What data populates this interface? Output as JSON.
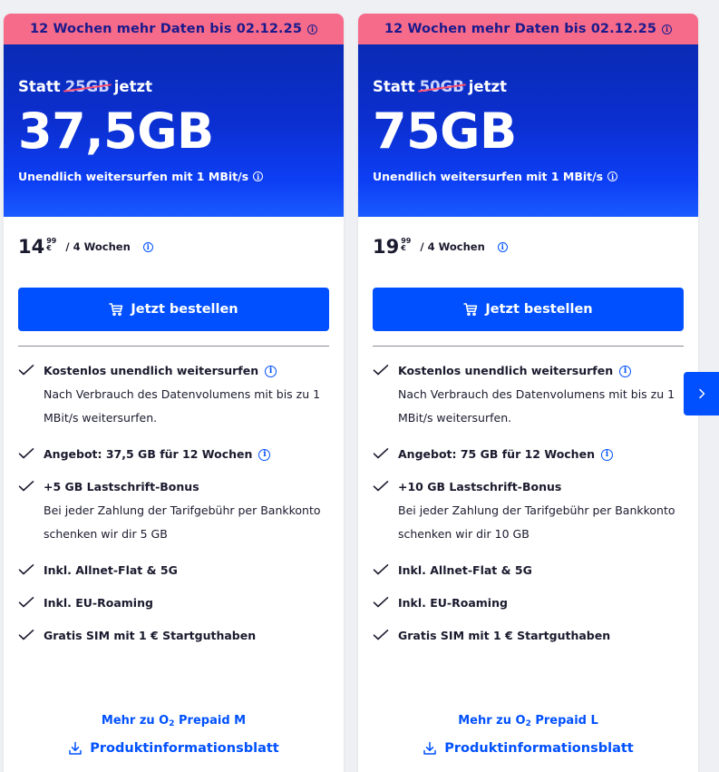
{
  "colors": {
    "promo_bg": "#f76b8a",
    "promo_text": "#1a1a8c",
    "hero_blue": "#0a2bb4",
    "accent_blue": "#0050ff",
    "strike_red": "#ff4d6d"
  },
  "icons": [
    "info-icon",
    "cart-icon",
    "check-icon",
    "download-icon",
    "chevron-right-icon"
  ],
  "cards": [
    {
      "promo": "12 Wochen mehr Daten bis 02.12.25",
      "statt_prefix": "Statt",
      "old_volume": "25GB",
      "statt_suffix": "jetzt",
      "new_volume": "37,5GB",
      "surf_text": "Unendlich weitersurfen mit 1 MBit/s",
      "price_main": "14",
      "price_cents": "99",
      "currency": "€",
      "period": "/ 4 Wochen",
      "order_label": "Jetzt bestellen",
      "features": [
        {
          "title": "Kostenlos unendlich weitersurfen",
          "info": true,
          "desc": "Nach Verbrauch des Datenvolumens mit bis zu 1 MBit/s weitersurfen."
        },
        {
          "title": "Angebot: 37,5 GB für 12 Wochen",
          "info": true,
          "desc": ""
        },
        {
          "title": "+5 GB Lastschrift-Bonus",
          "info": false,
          "desc": "Bei jeder Zahlung der Tarifgebühr per Bankkonto schenken wir dir 5 GB"
        },
        {
          "title": "Inkl. Allnet-Flat & 5G",
          "info": false,
          "desc": ""
        },
        {
          "title": "Inkl. EU-Roaming",
          "info": false,
          "desc": ""
        },
        {
          "title": "Gratis SIM mit 1 € Startguthaben",
          "info": false,
          "desc": ""
        }
      ],
      "more_prefix": "Mehr zu O",
      "more_sub": "2",
      "more_suffix": " Prepaid M",
      "pib_label": "Produktinformationsblatt"
    },
    {
      "promo": "12 Wochen mehr Daten bis 02.12.25",
      "statt_prefix": "Statt",
      "old_volume": "50GB",
      "statt_suffix": "jetzt",
      "new_volume": "75GB",
      "surf_text": "Unendlich weitersurfen mit 1 MBit/s",
      "price_main": "19",
      "price_cents": "99",
      "currency": "€",
      "period": "/ 4 Wochen",
      "order_label": "Jetzt bestellen",
      "features": [
        {
          "title": "Kostenlos unendlich weitersurfen",
          "info": true,
          "desc": "Nach Verbrauch des Datenvolumens mit bis zu 1 MBit/s weitersurfen."
        },
        {
          "title": "Angebot: 75 GB für 12 Wochen",
          "info": true,
          "desc": ""
        },
        {
          "title": "+10 GB Lastschrift-Bonus",
          "info": false,
          "desc": "Bei jeder Zahlung der Tarifgebühr per Bankkonto schenken wir dir 10 GB"
        },
        {
          "title": "Inkl. Allnet-Flat & 5G",
          "info": false,
          "desc": ""
        },
        {
          "title": "Inkl. EU-Roaming",
          "info": false,
          "desc": ""
        },
        {
          "title": "Gratis SIM mit 1 € Startguthaben",
          "info": false,
          "desc": ""
        }
      ],
      "more_prefix": "Mehr zu O",
      "more_sub": "2",
      "more_suffix": " Prepaid L",
      "pib_label": "Produktinformationsblatt"
    }
  ]
}
